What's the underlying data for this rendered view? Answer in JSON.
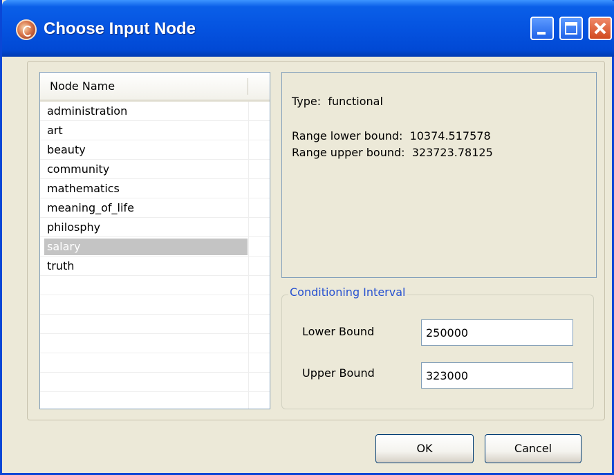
{
  "window": {
    "title": "Choose Input Node",
    "controls": [
      "minimize-icon",
      "maximize-icon",
      "close-icon"
    ],
    "accent_color": "#0553e0"
  },
  "node_list": {
    "header": "Node Name",
    "rows": [
      "administration",
      "art",
      "beauty",
      "community",
      "mathematics",
      "meaning_of_life",
      "philosphy",
      "salary",
      "truth",
      "",
      "",
      "",
      "",
      "",
      "",
      "",
      ""
    ],
    "selected": "salary"
  },
  "info": {
    "type_line": "Type:  functional",
    "lower_line": "Range lower bound:  10374.517578",
    "upper_line": "Range upper bound:  323723.78125"
  },
  "conditioning": {
    "legend": "Conditioning Interval",
    "lower_label": "Lower Bound",
    "lower_value": "250000",
    "upper_label": "Upper Bound",
    "upper_value": "323000"
  },
  "buttons": {
    "ok": "OK",
    "cancel": "Cancel"
  }
}
